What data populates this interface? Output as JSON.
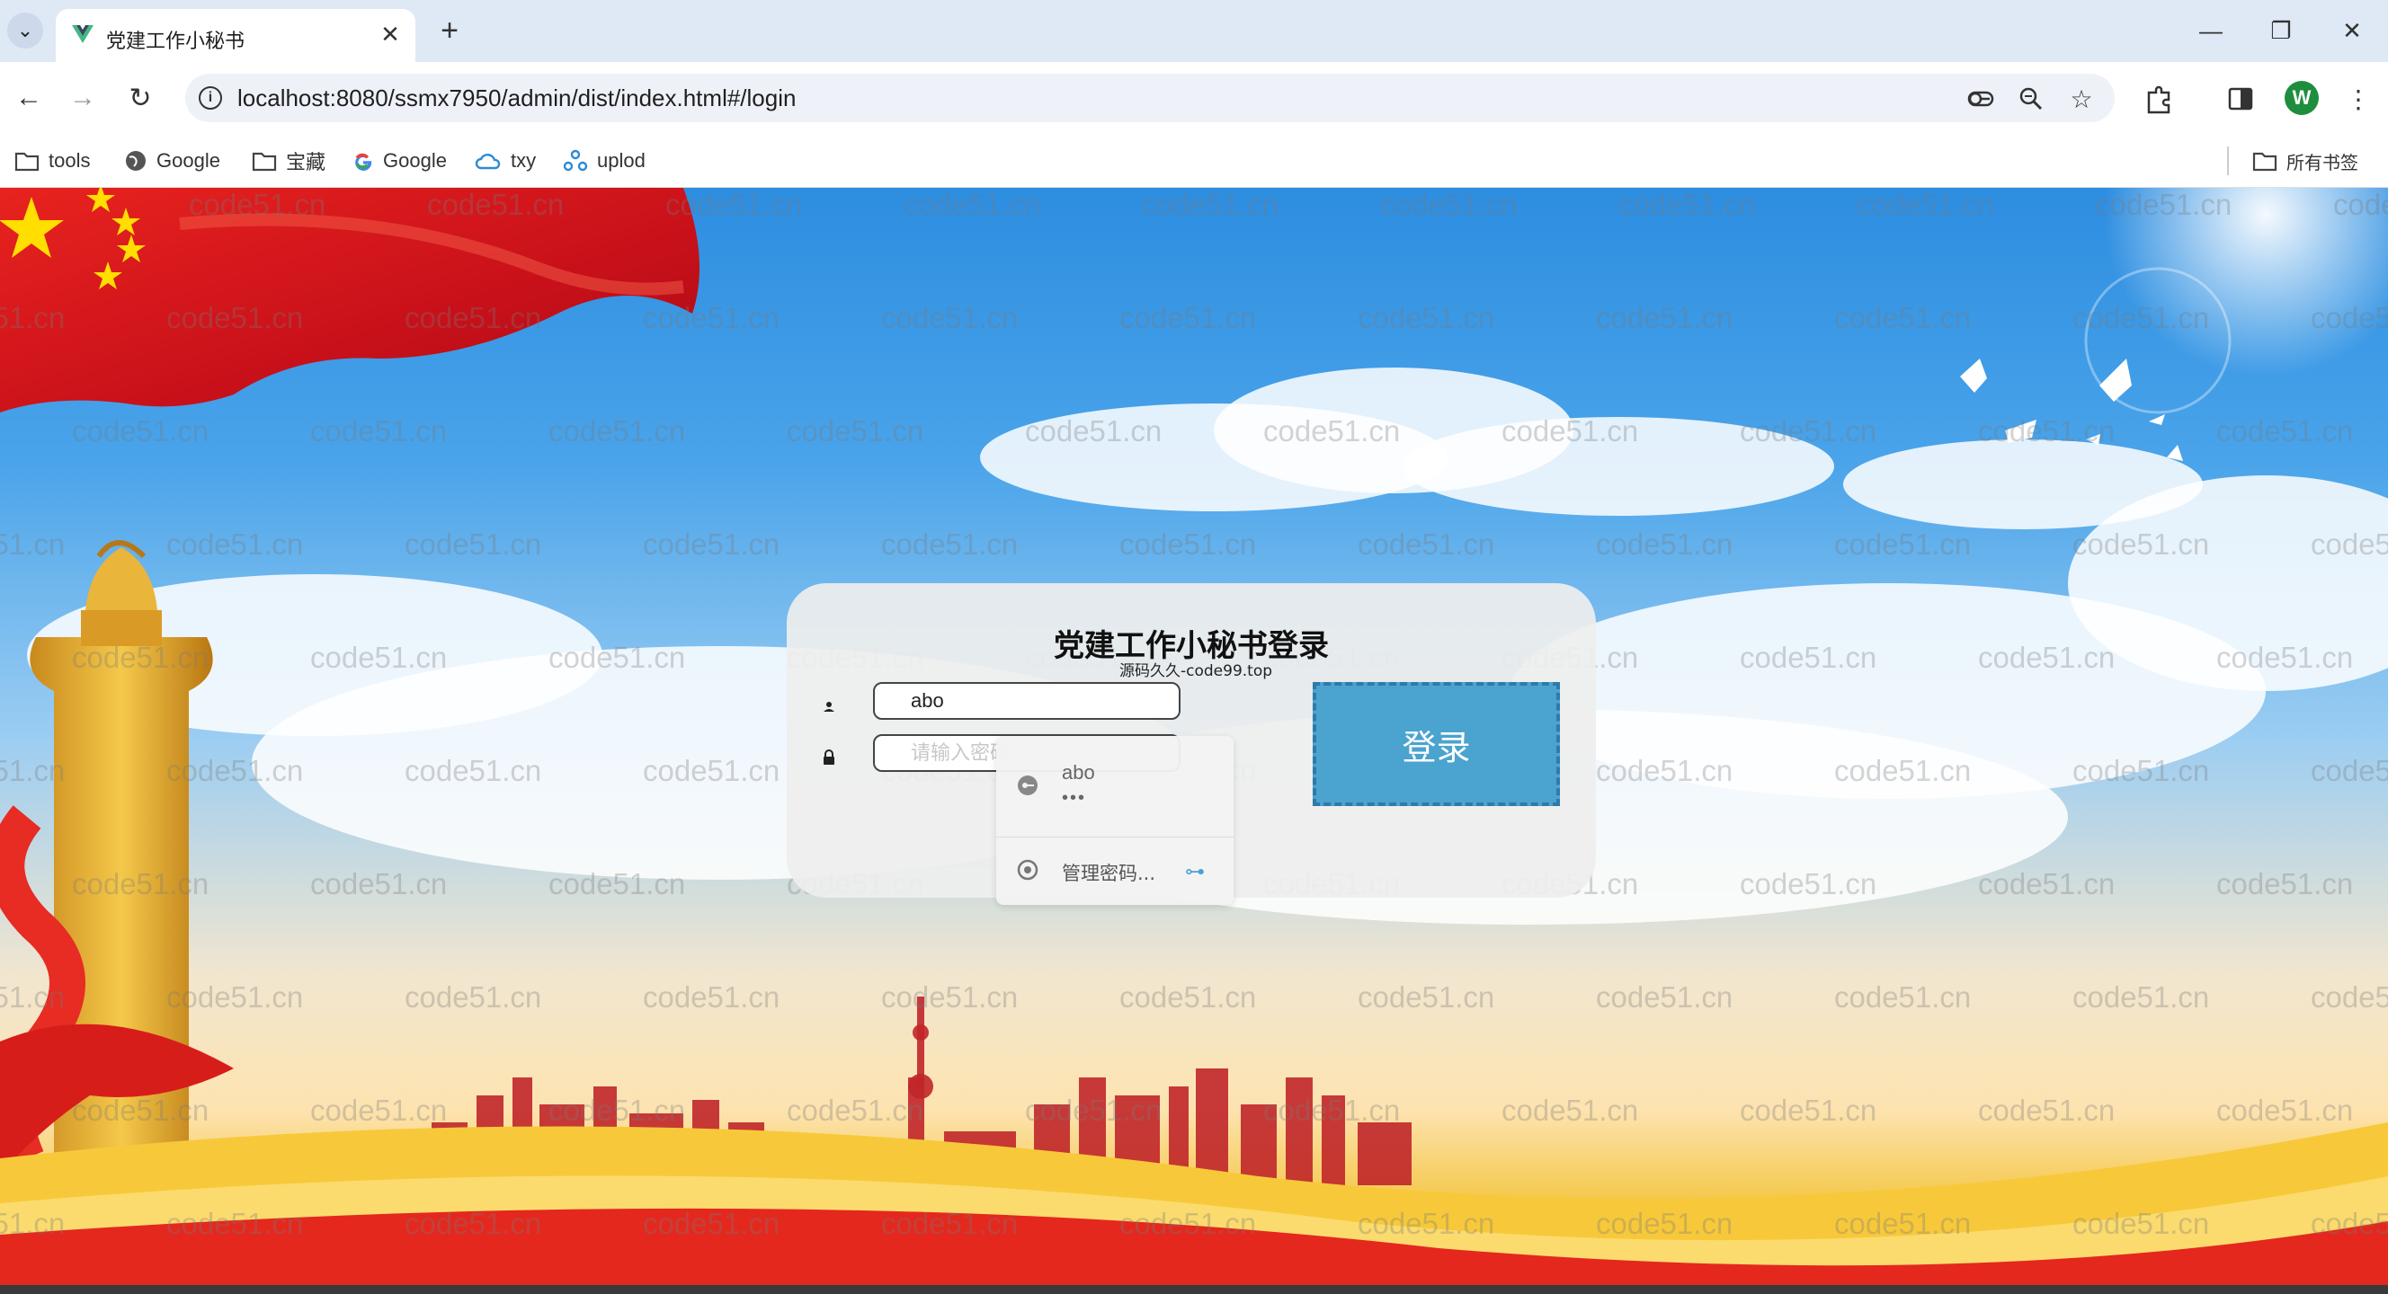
{
  "browser": {
    "tab": {
      "title": "党建工作小秘书",
      "close": "✕"
    },
    "new_tab": "+",
    "url": "localhost:8080/ssmx7950/admin/dist/index.html#/login",
    "bookmarks": [
      {
        "label": "tools",
        "icon": "folder-icon"
      },
      {
        "label": "Google",
        "icon": "globe-icon"
      },
      {
        "label": "宝藏",
        "icon": "folder-icon"
      },
      {
        "label": "Google",
        "icon": "google-icon"
      },
      {
        "label": "txy",
        "icon": "cloud-icon"
      },
      {
        "label": "uplod",
        "icon": "share-icon"
      }
    ],
    "all_bookmarks": "所有书签",
    "profile_initial": "W"
  },
  "login": {
    "title": "党建工作小秘书登录",
    "subtitle": "源码久久-code99.top",
    "username_value": "abo",
    "password_placeholder": "请输入密码",
    "submit": "登录"
  },
  "autofill": {
    "username": "abo",
    "password_mask": "•••",
    "manage": "管理密码..."
  },
  "watermark": "code51.cn",
  "colors": {
    "login_button": "#4ba3cf",
    "flag_red": "#d9141b",
    "gold": "#f5c94e"
  }
}
